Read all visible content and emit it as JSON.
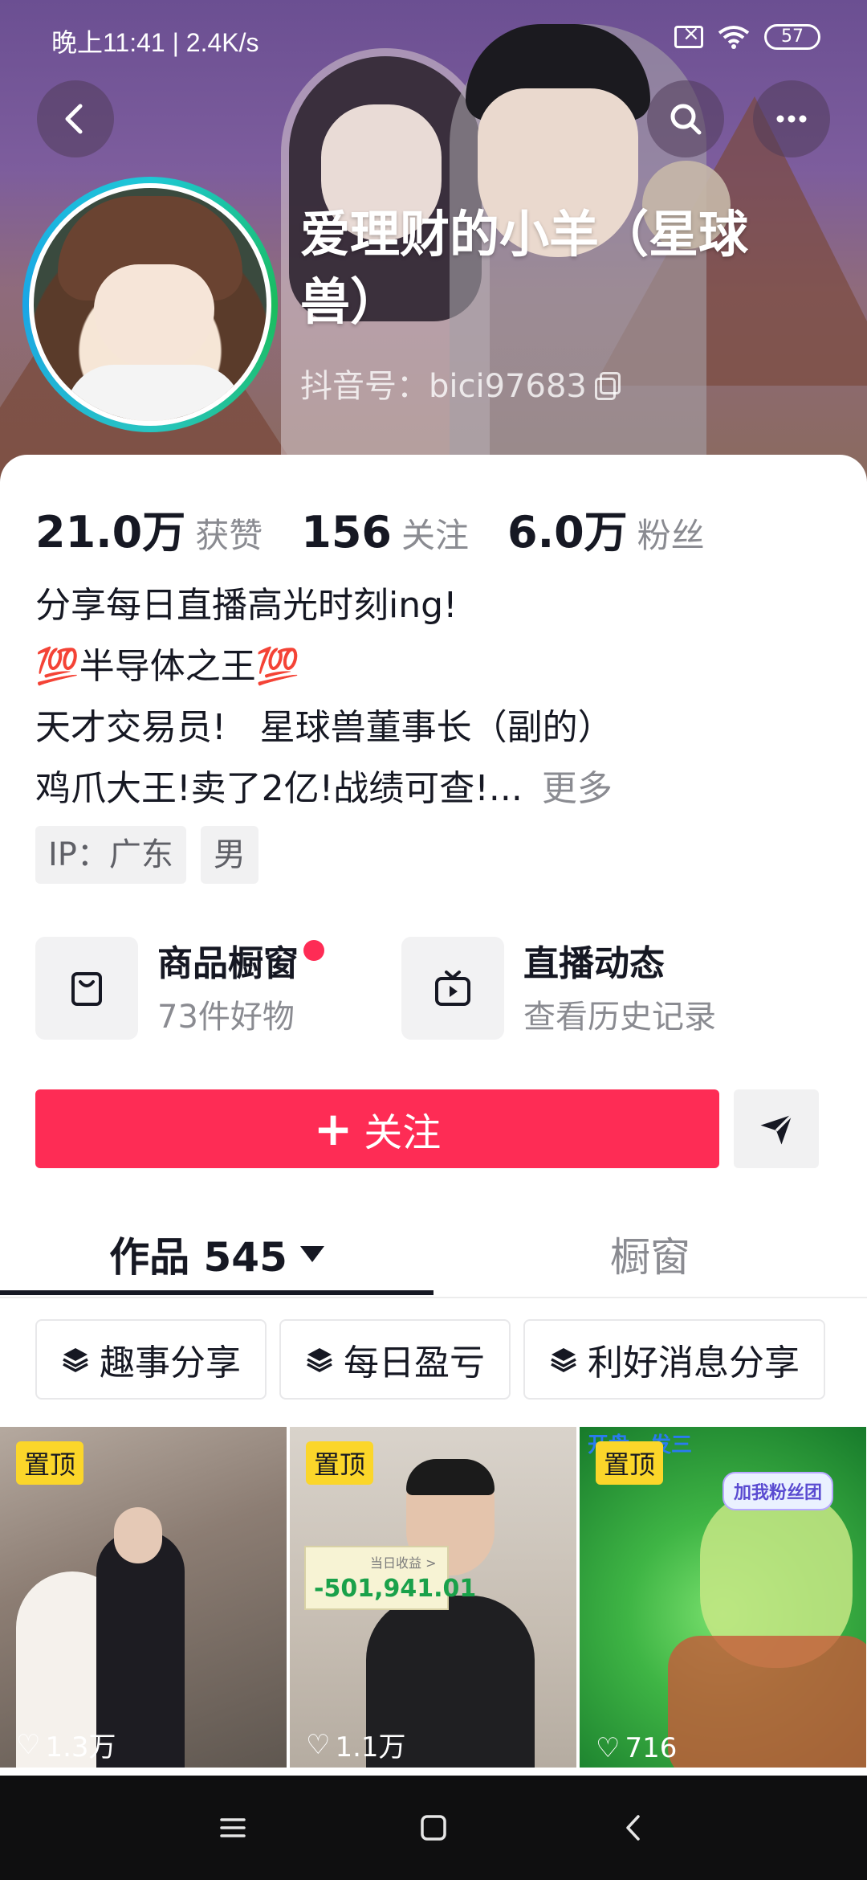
{
  "status_bar": {
    "time_speed": "晚上11:41 | 2.4K/s",
    "battery": "57"
  },
  "profile": {
    "name": "爱理财的小羊（星球兽）",
    "douyin_id": "抖音号：bici97683"
  },
  "stats": [
    {
      "value": "21.0万",
      "label": "获赞"
    },
    {
      "value": "156",
      "label": "关注"
    },
    {
      "value": "6.0万",
      "label": "粉丝"
    }
  ],
  "bio": {
    "line1": "分享每日直播高光时刻ing!",
    "line2_emoji_left": "💯",
    "line2_text": "半导体之王",
    "line2_emoji_right": "💯",
    "line3": "天才交易员!   星球兽董事长（副的）",
    "line4": "鸡爪大王!卖了2亿!战绩可查!...",
    "more": "更多"
  },
  "tags": [
    "IP：广东",
    "男"
  ],
  "features": {
    "shop": {
      "title": "商品橱窗",
      "subtitle": "73件好物"
    },
    "live": {
      "title": "直播动态",
      "subtitle": "查看历史记录"
    }
  },
  "actions": {
    "follow_plus": "+",
    "follow_label": "关注"
  },
  "tabs": {
    "works": "作品 545",
    "window": "橱窗"
  },
  "collections": [
    "趣事分享",
    "每日盈亏",
    "利好消息分享"
  ],
  "videos": [
    {
      "pin": "置顶",
      "likes": "1.3万"
    },
    {
      "pin": "置顶",
      "likes": "1.1万",
      "pnl_title": "当日收益 >",
      "pnl_value": "-501,941.01"
    },
    {
      "pin": "置顶",
      "likes": "716",
      "badge": "加我粉丝团",
      "top_text": "开盘一发三"
    }
  ],
  "colors": {
    "accent": "#fe2c55",
    "pin_bg": "#fbd62a",
    "avatar_ring": "#1ec8d6"
  }
}
